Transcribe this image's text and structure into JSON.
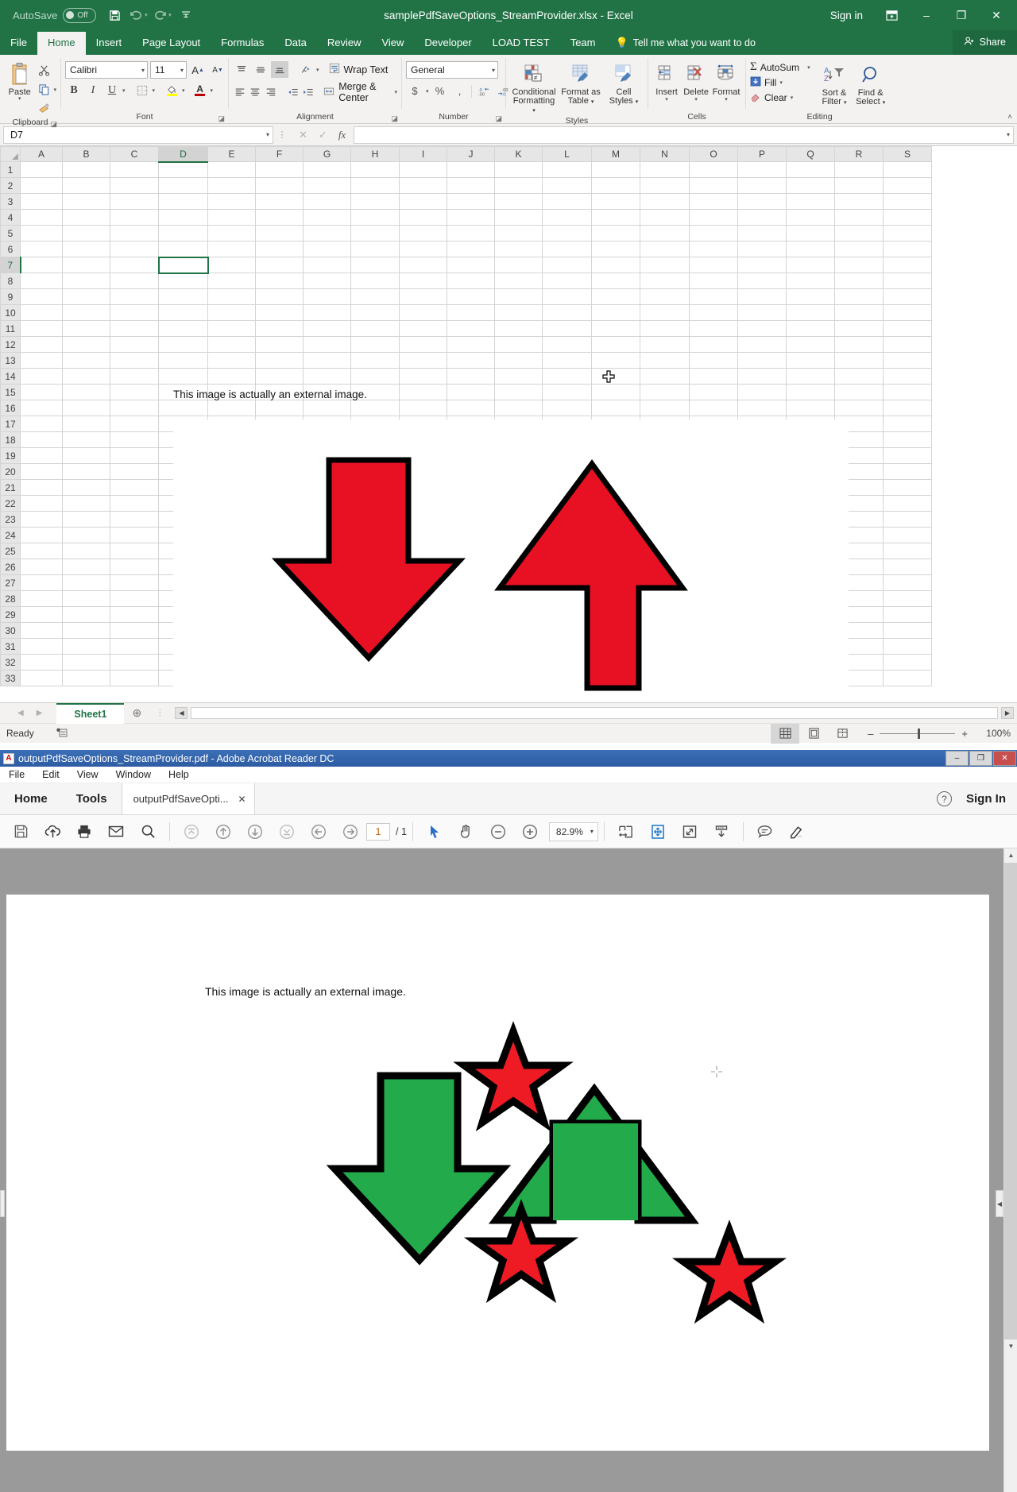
{
  "excel": {
    "titlebar": {
      "autosave_label": "AutoSave",
      "autosave_state": "Off",
      "save_icon": "save-icon",
      "undo_icon": "undo-icon",
      "redo_icon": "redo-icon",
      "customize_icon": "customize-qat-icon",
      "title": "samplePdfSaveOptions_StreamProvider.xlsx  -  Excel",
      "signin": "Sign in",
      "ribbon_display_icon": "ribbon-display-options-icon",
      "minimize": "–",
      "restore": "❐",
      "close": "✕"
    },
    "tabs": [
      {
        "label": "File",
        "active": false
      },
      {
        "label": "Home",
        "active": true
      },
      {
        "label": "Insert",
        "active": false
      },
      {
        "label": "Page Layout",
        "active": false
      },
      {
        "label": "Formulas",
        "active": false
      },
      {
        "label": "Data",
        "active": false
      },
      {
        "label": "Review",
        "active": false
      },
      {
        "label": "View",
        "active": false
      },
      {
        "label": "Developer",
        "active": false
      },
      {
        "label": "LOAD TEST",
        "active": false
      },
      {
        "label": "Team",
        "active": false
      }
    ],
    "tellme": "Tell me what you want to do",
    "share": "Share",
    "ribbon": {
      "clipboard": {
        "group_label": "Clipboard",
        "paste": "Paste",
        "cut_icon": "cut-scissors-icon",
        "copy_icon": "copy-icon",
        "format_painter_icon": "format-painter-icon"
      },
      "font": {
        "group_label": "Font",
        "font_name": "Calibri",
        "font_size": "11",
        "grow_font": "A",
        "shrink_font": "A",
        "bold": "B",
        "italic": "I",
        "underline": "U",
        "borders_icon": "borders-icon",
        "fill_color_icon": "fill-color-icon",
        "font_color_icon": "font-color-icon"
      },
      "alignment": {
        "group_label": "Alignment",
        "wrap_text": "Wrap Text",
        "merge_center": "Merge & Center",
        "orientation_icon": "text-orientation-icon",
        "top_align_icon": "align-top-icon",
        "middle_align_icon": "align-middle-icon",
        "bottom_align_icon": "align-bottom-icon",
        "left_align_icon": "align-left-icon",
        "center_align_icon": "align-center-icon",
        "right_align_icon": "align-right-icon",
        "decrease_indent_icon": "decrease-indent-icon",
        "increase_indent_icon": "increase-indent-icon"
      },
      "number": {
        "group_label": "Number",
        "format": "General",
        "currency": "$",
        "percent": "%",
        "comma": ",",
        "decrease_decimal_icon": "decrease-decimal-icon",
        "increase_decimal_icon": "increase-decimal-icon"
      },
      "styles": {
        "group_label": "Styles",
        "conditional_formatting": "Conditional Formatting",
        "format_as_table": "Format as Table",
        "cell_styles": "Cell Styles"
      },
      "cells": {
        "group_label": "Cells",
        "insert": "Insert",
        "delete": "Delete",
        "format": "Format"
      },
      "editing": {
        "group_label": "Editing",
        "autosum": "AutoSum",
        "fill": "Fill",
        "clear": "Clear",
        "sort_filter": "Sort & Filter",
        "find_select": "Find & Select"
      }
    },
    "formula_bar": {
      "name_box": "D7",
      "cancel_icon": "cancel-icon",
      "enter_icon": "enter-check-icon",
      "function_icon": "fx",
      "formula_value": ""
    },
    "grid": {
      "columns": [
        "A",
        "B",
        "C",
        "D",
        "E",
        "F",
        "G",
        "H",
        "I",
        "J",
        "K",
        "L",
        "M",
        "N",
        "O",
        "P",
        "Q",
        "R",
        "S"
      ],
      "selected_column": "D",
      "selected_row": 7,
      "rows": [
        1,
        2,
        3,
        4,
        5,
        6,
        7,
        8,
        9,
        10,
        11,
        12,
        13,
        14,
        15,
        16,
        17,
        18,
        19,
        20,
        21,
        22,
        23,
        24,
        25,
        26,
        27,
        28,
        29,
        30,
        31,
        32,
        33
      ],
      "cell_text": "This image is actually an external image."
    },
    "sheet_tabs": {
      "prev_icon": "prev-sheet-icon",
      "next_icon": "next-sheet-icon",
      "sheets": [
        "Sheet1"
      ],
      "add_sheet_icon": "add-sheet-icon"
    },
    "status_bar": {
      "status": "Ready",
      "macro_icon": "record-macro-icon",
      "normal_view_icon": "normal-view-icon",
      "page_layout_icon": "page-layout-view-icon",
      "page_break_icon": "page-break-preview-icon",
      "zoom_out": "–",
      "zoom_in": "+",
      "zoom": "100%"
    }
  },
  "acrobat": {
    "title": "outputPdfSaveOptions_StreamProvider.pdf - Adobe Acrobat Reader DC",
    "window_buttons": {
      "minimize": "–",
      "restore": "❐",
      "close": "✕"
    },
    "menu": [
      "File",
      "Edit",
      "View",
      "Window",
      "Help"
    ],
    "home_tab": "Home",
    "tools_tab": "Tools",
    "doc_tab": "outputPdfSaveOpti...",
    "doc_tab_close": "✕",
    "help_icon": "help-question-icon",
    "signin": "Sign In",
    "toolbar": {
      "save_icon": "save-file-icon",
      "upload_icon": "upload-cloud-icon",
      "print_icon": "print-icon",
      "email_icon": "email-envelope-icon",
      "search_icon": "search-magnifier-icon",
      "first_page_icon": "first-page-icon",
      "prev_page_icon": "previous-page-up-icon",
      "next_page_icon": "next-page-down-icon",
      "last_page_icon": "last-page-icon",
      "prev_view_icon": "previous-view-back-icon",
      "next_view_icon": "next-view-forward-icon",
      "page_number": "1",
      "page_total": "/ 1",
      "select_tool_icon": "select-cursor-icon",
      "hand_tool_icon": "hand-pan-icon",
      "zoom_out_icon": "zoom-out-icon",
      "zoom_in_icon": "zoom-in-icon",
      "zoom_level": "82.9%",
      "fit_width_icon": "fit-width-icon",
      "fit_page_icon": "fit-page-icon",
      "fullscreen_icon": "fullscreen-icon",
      "scroll_mode_icon": "scroll-mode-icon",
      "comment_icon": "comment-bubble-icon",
      "highlight_icon": "highlight-pen-icon"
    },
    "document": {
      "text": "This image is actually an external image."
    }
  },
  "colors": {
    "excel_green": "#217346",
    "arrow_red": "#e81123",
    "arrow_green": "#22aa4b",
    "star_red": "#ef1b24",
    "acrobat_blue": "#2d5ca3"
  }
}
